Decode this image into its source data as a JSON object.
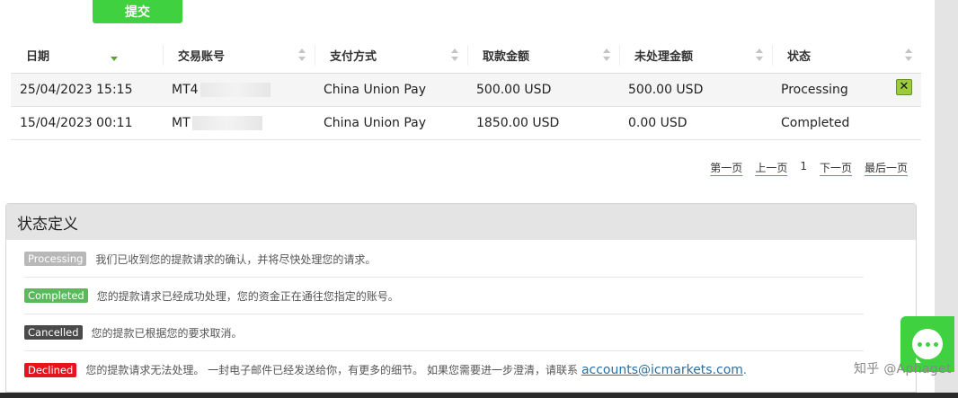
{
  "submit": {
    "label": "提交"
  },
  "table": {
    "columns": [
      "日期",
      "交易账号",
      "支付方式",
      "取款金额",
      "未处理金额",
      "状态"
    ],
    "rows": [
      {
        "date": "25/04/2023 15:15",
        "account": "MT4",
        "method": "China Union Pay",
        "amount": "500.00 USD",
        "pending": "500.00 USD",
        "status": "Processing",
        "cancel": "✕"
      },
      {
        "date": "15/04/2023 00:11",
        "account": "MT",
        "method": "China Union Pay",
        "amount": "1850.00 USD",
        "pending": "0.00 USD",
        "status": "Completed"
      }
    ]
  },
  "pager": {
    "first": "第一页",
    "prev": "上一页",
    "current": "1",
    "next": "下一页",
    "last": "最后一页"
  },
  "legend": {
    "title": "状态定义",
    "items": [
      {
        "badge": "Processing",
        "color": "#b8b8b8",
        "text": "我们已收到您的提款请求的确认，并将尽快处理您的请求。"
      },
      {
        "badge": "Completed",
        "color": "#5cb85c",
        "text": "您的提款请求已经成功处理，您的资金正在通往您指定的账号。"
      },
      {
        "badge": "Cancelled",
        "color": "#4a4a4a",
        "text": "您的提款已根据您的要求取消。"
      },
      {
        "badge": "Declined",
        "color": "#e8141c",
        "text": "您的提款请求无法处理。 一封电子邮件已经发送给你，有更多的细节。 如果您需要进一步澄清，请联系",
        "link": "accounts@icmarkets.com",
        "tail": "."
      }
    ]
  },
  "watermark": "知乎 @Aphaget"
}
